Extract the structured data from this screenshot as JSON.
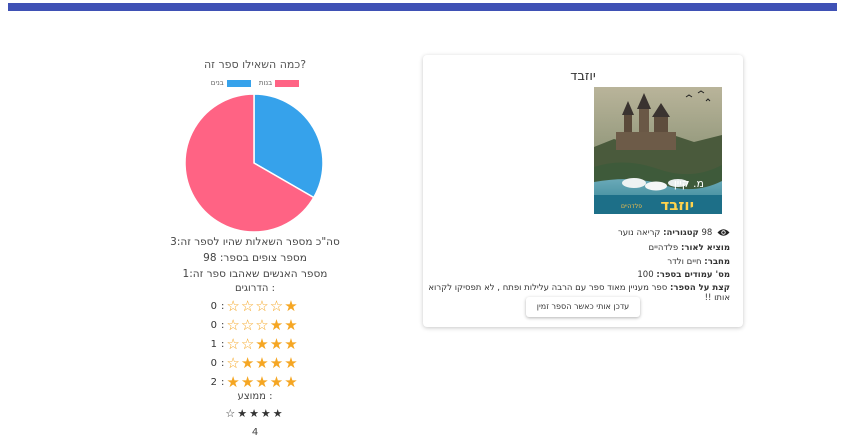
{
  "stats": {
    "chart_title": "כמה השאילו ספר זה?",
    "legend": [
      {
        "name": "בנות",
        "color": "#ff6384"
      },
      {
        "name": "בנים",
        "color": "#36a2eb"
      }
    ],
    "total_questions_line": "סה\"כ מספר השאלות שהיו לספר זה:3",
    "views_line": "מספר צופים בספר: 98",
    "likes_line": "מספר האנשים שאהבו ספר זה:1",
    "ratings_label": "הדרוגים :",
    "average_label": "ממוצע :",
    "average_value": "4",
    "average_stars": "☆★★★★",
    "stars_on_counts": [
      0,
      2,
      3,
      4,
      5
    ]
  },
  "chart_data": {
    "type": "pie",
    "title": "כמה השאילו ספר זה?",
    "labels": [
      "בנות",
      "בנים"
    ],
    "values": [
      2,
      1
    ],
    "colors": [
      "#ff6384",
      "#36a2eb"
    ]
  },
  "ratings": [
    {
      "count": "0",
      "filled": 1
    },
    {
      "count": "0",
      "filled": 2
    },
    {
      "count": "1",
      "filled": 3
    },
    {
      "count": "0",
      "filled": 4
    },
    {
      "count": "2",
      "filled": 5
    }
  ],
  "book": {
    "title": "יוזבד",
    "views": "98",
    "category_label": "קטגוריה:",
    "category_value": " קריאה נוער",
    "publisher_label": "מוציא לאור:",
    "publisher_value": " פלדהיים",
    "author_label": "מחבר:",
    "author_value": " חיים ולדר",
    "pages_label": "מס' עמודים בספר:",
    "pages_value": " 100",
    "about_label": "קצת על הספר:",
    "about_value": " ספר מעניין מאוד ספר עם הרבה עלילות ופתח , לא תפסיקו לקרוא אותו !!",
    "cover_author": "מ. קיין",
    "cover_title": "יוזבד",
    "cover_publisher": "פלדהיים",
    "notify_button": "עדכן אותי כאשר הספר זמין"
  }
}
